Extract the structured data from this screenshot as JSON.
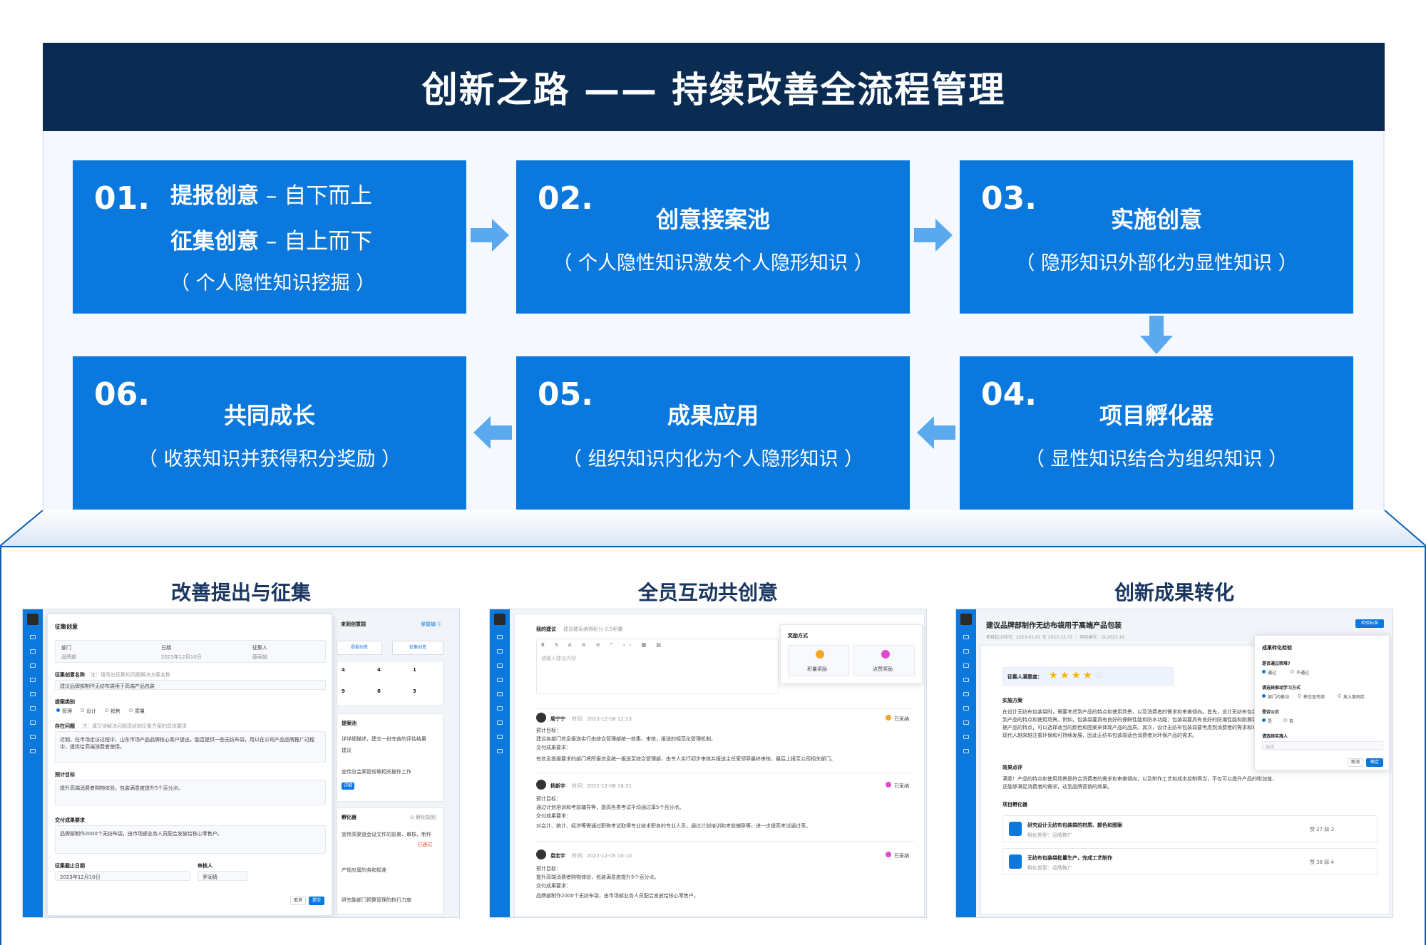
{
  "header": {
    "title": "创新之路 —— 持续改善全流程管理"
  },
  "steps": {
    "s1": {
      "num": "01.",
      "line1_bold": "提报创意",
      "line1_rest": " – 自下而上",
      "line2_bold": "征集创意",
      "line2_rest": " – 自上而下",
      "line3": "（ 个人隐性知识挖掘 ）"
    },
    "s2": {
      "num": "02.",
      "title": "创意接案池",
      "sub": "（ 个人隐性知识激发个人隐形知识 ）"
    },
    "s3": {
      "num": "03.",
      "title": "实施创意",
      "sub": "（ 隐形知识外部化为显性知识 ）"
    },
    "s4": {
      "num": "04.",
      "title": "项目孵化器",
      "sub": "（ 显性知识结合为组织知识 ）"
    },
    "s5": {
      "num": "05.",
      "title": "成果应用",
      "sub": "（ 组织知识内化为个人隐形知识 ）"
    },
    "s6": {
      "num": "06.",
      "title": "共同成长",
      "sub": "（ 收获知识并获得积分奖励 ）"
    }
  },
  "screens": {
    "a": {
      "title": "改善提出与征集",
      "dialog_title": "征集创意",
      "col_dept": "部门",
      "col_date": "日期",
      "col_person": "征集人",
      "val_dept": "品牌部",
      "val_date": "2023年12月10日",
      "val_person": "薛丽娟",
      "name_label": "征集创意名称",
      "name_hint": "注：填写应征集的问题解决方案名称",
      "name_value": "建议品牌部制作无纺布袋用于高端产品包装",
      "type_label": "提案类别",
      "types": [
        "管理",
        "设计",
        "销售",
        "质量"
      ],
      "problem_label": "存在问题",
      "problem_hint": "注：填写待解决问题现状和征集方案的具体要求",
      "problem_text": "近期，在市场走访过程中，山东市场产品品牌核心客户提出，能否提供一些无纺布袋，用以在公司产品品牌推广过程中，提供给高端消费者使用。",
      "goal_label": "预计目标",
      "goal_text": "提升高端消费者购物体验，包装满意度提升5个百分点。",
      "deliver_label": "交付成果要求",
      "deliver_text": "品牌部制作2000个无纺布袋，由市场部业务人员配合发放给核心零售户。",
      "deadline_label": "征集截止日期",
      "deadline_value": "2023年12月10日",
      "reviewer_label": "审核人",
      "reviewer_value": "罗润倩",
      "cancel": "取消",
      "submit": "提交",
      "right_title": "来到创意园",
      "right_link": "掌握编 ⓘ",
      "btn1": "提报创意",
      "btn2": "征集创意",
      "stats": [
        "4",
        "4",
        "1",
        "9",
        "8",
        "3"
      ],
      "pool_title": "提案池",
      "pool_line1": "详详细描述，建交一份完善的评估结果",
      "pool_line2": "建议",
      "pool_line3": "宣传应会案管前做相关操作工作",
      "pool_tag": "详细",
      "inc_title": "孵化器",
      "inc_link": "⊙ 孵化规则",
      "inc_line1": "宣传高渠道会设文件的前景、审核、制作",
      "inc_line2": "产规应属的务和规准",
      "inc_line3": "研究能部门预算管理的执行力度",
      "inc_tag": "已通过"
    },
    "b": {
      "title": "全员互动共创意",
      "my_title": "我的建议",
      "my_hint": "建议被采纳得积分 0.5积量",
      "placeholder": "请输入建议内容",
      "reward_title": "奖励方式",
      "reward1": "积量奖励",
      "reward2": "点赞奖励",
      "c1_name": "周宁宁",
      "c1_time": "时间：2023-12-08 12:23",
      "c1_tag": "已采纳",
      "c1_goal": "预计目标：",
      "c1_goal_text": "建议各部门信息报送实行由综合管理部统一收集、审核，报送的规范化管理机制。",
      "c1_deliver": "交付成果要求：",
      "c1_deliver_text": "有信息提报要求的部门将所报信息统一报送至综合管理部，由专人实行初步审核并报送主任室领导最终审核，最后上报至公司相关部门。",
      "c2_name": "杨新宇",
      "c2_time": "时间：2022-12-06 16:31",
      "c2_tag": "已采纳",
      "c2_goal": "预计目标：",
      "c2_goal_text": "通过计划培训和考前辅导等，提高各类考试平均通过率5个百分点。",
      "c2_deliver": "交付成果要求：",
      "c2_deliver_text": "对会计、统计、经济等需通过职称考试取得专业技术职务的专业人员，通过计划培训和考前辅导等，进一步提高考试通过率。",
      "c3_name": "袁宏宇",
      "c3_time": "时间：2022-12-05 10:10",
      "c3_tag": "已采纳",
      "c3_goal": "预计目标：",
      "c3_goal_text": "提升高端消费者购物体验，包装满意度提升5个百分点。",
      "c3_deliver": "交付成果要求：",
      "c3_deliver_text": "品牌部制作2000个无纺布袋，由市场部业务人员配合发放给核心零售户。"
    },
    "c": {
      "title": "创新成果转化",
      "doc_title": "建议品牌部制作无纺布袋用于高端产品包装",
      "doc_meta": "项目起止时间：2023-01-01 至 2023-12-31  ｜  项目编号：GL2023-16",
      "action_btn": "检验标准",
      "sat_label": "征集人满意度：",
      "stars": 4,
      "plan_label": "实施方案",
      "plan_text": "在设计无纺布包装袋时，需要考虑到产品的特点和使用场景，以及消费者的需求和审美倾向。首先，设计无纺布包装袋要考虑到产品的特点和使用场景。例如，包装袋要具有良好的保鲜性能和防水功能；包装袋要具有良好的防潮性能和耐撕裂性能。根据产品的特点，可以选择适当的颜色和图案来体现产品的品质。其次，设计无纺布包装袋要考虑到消费者的需求和审美倾向。现代人越来越注重环保和可持续发展，因此无纺布包装袋适合消费者对环保产品的需求。",
      "eval_label": "效果点评",
      "eval_text": "满意！产品的特点和使用场景是符合消费者的需求和审美倾向，以及制作工艺和成本控制得当，不仅可以提升产品的附加值，还能够满足消费者的需求，达到品牌营销的效果。",
      "inc_label": "项目孵化器",
      "item1_title": "研究设计无纺布包装袋的材质、颜色和图案",
      "item1_sub": "孵化类型：品牌推广",
      "item1_stats": "赞·27    踩·3",
      "item2_title": "无纺布包装袋批量生产，完成工艺制作",
      "item2_sub": "孵化类型：品牌推广",
      "item2_stats": "赞·38    踩·4",
      "check_title": "成果转化检验",
      "q1": "是否通过转难?",
      "q1_opts": [
        "通过",
        "不通过"
      ],
      "q2": "请选择推动学习方式",
      "q2_opts": [
        "部门内推动",
        "移交宣传部",
        "放入案例库"
      ],
      "q3": "是否公示",
      "q3_opts": [
        "是",
        "否"
      ],
      "q4": "请选择实施人",
      "q4_placeholder": "选择",
      "cancel": "取消",
      "ok": "确定"
    }
  },
  "colors": {
    "header_bg": "#0a2b52",
    "card_bg": "#0b78dd",
    "arrow": "#5aa8ee",
    "accent": "#0b78dd"
  }
}
